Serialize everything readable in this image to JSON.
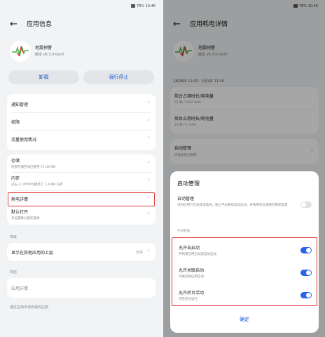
{
  "status_bar": {
    "text": "78% 10:46"
  },
  "left_screen": {
    "title": "应用信息",
    "app": {
      "name": "地震预警",
      "version": "版本 v6.3.0-test7"
    },
    "buttons": {
      "uninstall": "卸载",
      "force_stop": "强行停止"
    },
    "group1": [
      "通知管理",
      "权限",
      "流量使用情况"
    ],
    "storage": {
      "label": "存储",
      "detail": "内部存储空间已使用 71.09 MB"
    },
    "memory": {
      "label": "内存",
      "detail": "过去 3 小时平均使用了 1.4 MB 内存"
    },
    "battery": {
      "label": "耗电详情"
    },
    "default_open": {
      "label": "默认打开",
      "detail": "未设置默认操作选择"
    },
    "section_advanced": "高级",
    "overlay": {
      "label": "显示在其他应用的上层",
      "value": "允许"
    },
    "section_store": "商店",
    "app_details": "应用详情",
    "footer_note": "通过应用市场安装的应用"
  },
  "right_screen": {
    "title": "应用耗电详情",
    "app": {
      "name": "地震预警",
      "version": "版本 v6.3.0-test7"
    },
    "date_range": "2月28日 11:00 - 3月1日 11:00",
    "foreground": {
      "label": "前台占用时长/耗电量",
      "value": "57 秒 / 0.87 mAh"
    },
    "background": {
      "label": "后台占用时长/耗电量",
      "value": "15 秒 / 1 mAh"
    },
    "launch": {
      "label": "启动管理",
      "detail": "可能被后台限制"
    },
    "sheet": {
      "title": "启动管理",
      "auto": {
        "label": "自动管理",
        "desc": "识别应用行为及耗电情况，防止不必要的自动启动，并采用优化策略控制耗电量"
      },
      "manual_label": "手动管理",
      "auto_launch": {
        "label": "允许自启动",
        "desc": "开机或应用启动后自动启动",
        "on": true
      },
      "assoc_launch": {
        "label": "允许关联启动",
        "desc": "可被其他应用启动",
        "on": true
      },
      "bg_launch": {
        "label": "允许后台活动",
        "desc": "可在后台运行",
        "on": true
      },
      "confirm": "确定"
    }
  }
}
